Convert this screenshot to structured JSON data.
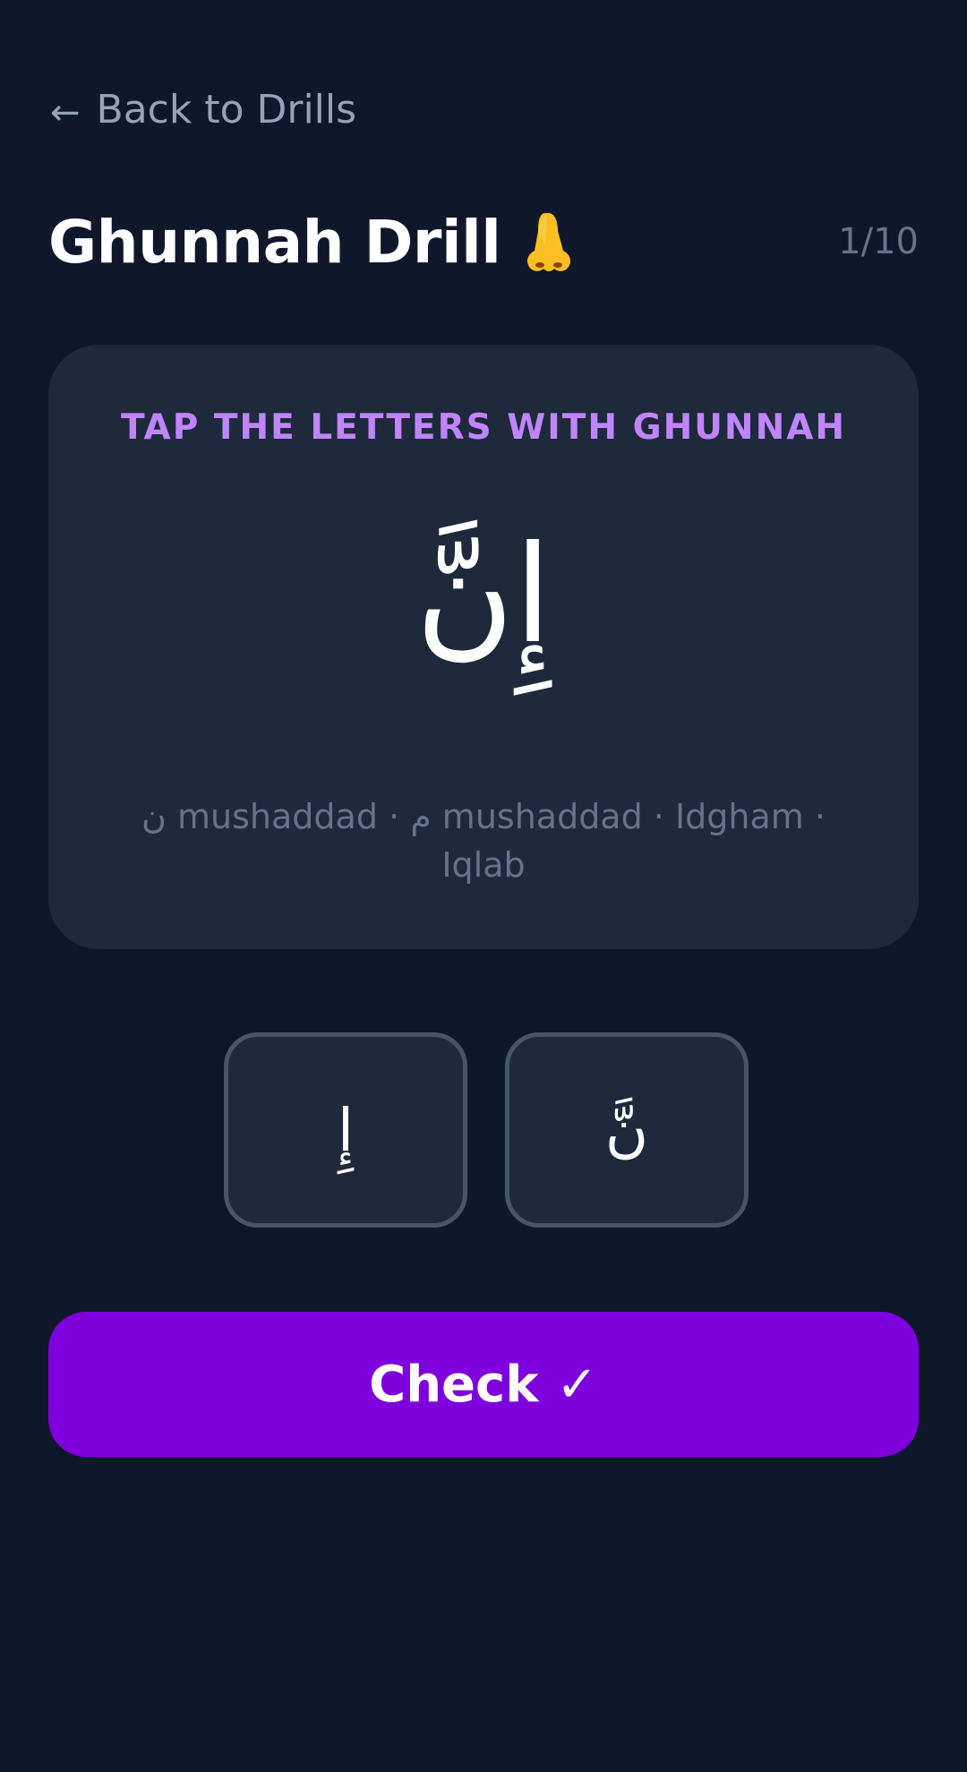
{
  "nav": {
    "back_arrow": "←",
    "back_label": "Back to Drills"
  },
  "header": {
    "title": "Ghunnah Drill",
    "icon": "nose-icon",
    "progress": "1/10"
  },
  "card": {
    "instruction": "TAP THE LETTERS WITH GHUNNAH",
    "word": "إِنَّ",
    "hint": "ن mushaddad · م mushaddad · Idgham · Iqlab"
  },
  "choices": [
    {
      "letter": "إِ"
    },
    {
      "letter": "نَّ"
    }
  ],
  "action": {
    "check_label": "Check ✓"
  },
  "colors": {
    "background": "#0f172a",
    "card": "#1e293b",
    "accent_purple": "#7e00dc",
    "instruction_purple": "#c084fc",
    "muted_text": "#64748b",
    "link_text": "#94a3b8",
    "choice_border": "#475569"
  }
}
